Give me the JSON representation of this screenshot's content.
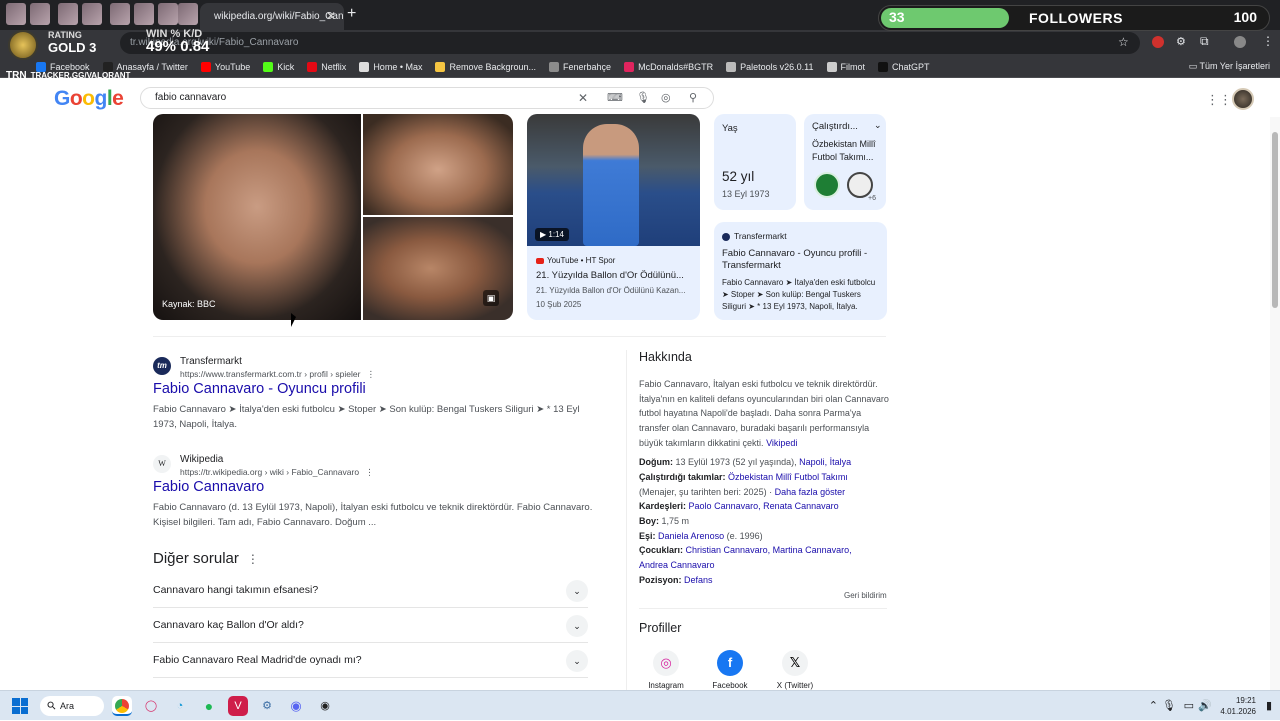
{
  "browser": {
    "active_tab_title": "wikipedia.org/wiki/Fabio_Cann",
    "address_text": "tr.wikipedia.org/wiki/Fabio_Cannavaro",
    "bookmarks": [
      {
        "label": "Facebook",
        "color": "#1877f2",
        "icon": "facebook-icon"
      },
      {
        "label": "Anasayfa / Twitter",
        "color": "#222222",
        "icon": "x-icon"
      },
      {
        "label": "YouTube",
        "color": "#ff0000",
        "icon": "youtube-icon"
      },
      {
        "label": "Kick",
        "color": "#53fc18",
        "icon": "kick-icon"
      },
      {
        "label": "Netflix",
        "color": "#e50914",
        "icon": "netflix-icon"
      },
      {
        "label": "Home • Max",
        "color": "#dddddd",
        "icon": "max-icon"
      },
      {
        "label": "Remove Backgroun...",
        "color": "#f5c542",
        "icon": "removebg-icon"
      },
      {
        "label": "Fenerbahçe",
        "color": "#8c8c8c",
        "icon": "fenerbahce-icon"
      },
      {
        "label": "McDonalds#BGTR",
        "color": "#e0245e",
        "icon": "mcdonalds-icon"
      },
      {
        "label": "Paletools v26.0.11",
        "color": "#bbbbbb",
        "icon": "paletools-icon"
      },
      {
        "label": "Filmot",
        "color": "#cccccc",
        "icon": "filmot-icon"
      },
      {
        "label": "ChatGPT",
        "color": "#111111",
        "icon": "chatgpt-icon"
      }
    ],
    "all_bookmarks_label": "Tüm Yer İşaretleri"
  },
  "overlay": {
    "followers_count": "33",
    "followers_label": "FOLLOWERS",
    "followers_goal": "100",
    "followers_progress": 0.33,
    "rating_label": "RATING",
    "rating_value": "GOLD 3",
    "winrate_label": "WIN %",
    "winrate_value": "49%",
    "kd_label": "K/D",
    "kd_value": "0.84",
    "tracker_brand": "TRN",
    "tracker_url": "TRACKER.GG/VALORANT"
  },
  "google": {
    "logo": "Google",
    "query": "fabio cannavaro",
    "image_source_label": "Kaynak: BBC",
    "video": {
      "duration": "1:14",
      "source": "YouTube • HT Spor",
      "title": "21. Yüzyılda Ballon d'Or Ödülünü...",
      "desc": "21. Yüzyılda Ballon d'Or Ödülünü Kazan...",
      "date": "10 Şub 2025"
    },
    "age_card": {
      "label": "Yaş",
      "value": "52 yıl",
      "date": "13 Eyl 1973"
    },
    "teams_card": {
      "label": "Çalıştırdı...",
      "value": "Özbekistan Millî Futbol Takımı...",
      "more": "+6"
    },
    "transfer_card": {
      "source": "Transfermarkt",
      "title": "Fabio Cannavaro - Oyuncu profili - Transfermarkt",
      "desc": "Fabio Cannavaro ➤ İtalya'den eski futbolcu ➤ Stoper ➤ Son kulüp: Bengal Tuskers Siliguri ➤ * 13 Eyl 1973, Napoli, İtalya."
    },
    "results": [
      {
        "site": "Transfermarkt",
        "url": "https://www.transfermarkt.com.tr › profil › spieler",
        "title": "Fabio Cannavaro - Oyuncu profili",
        "snippet": "Fabio Cannavaro ➤ İtalya'den eski futbolcu ➤ Stoper ➤ Son kulüp: Bengal Tuskers Siliguri ➤ * 13 Eyl 1973, Napoli, İtalya."
      },
      {
        "site": "Wikipedia",
        "url": "https://tr.wikipedia.org › wiki › Fabio_Cannavaro",
        "title": "Fabio Cannavaro",
        "snippet": "Fabio Cannavaro (d. 13 Eylül 1973, Napoli), İtalyan eski futbolcu ve teknik direktördür. Fabio Cannavaro. Kişisel bilgileri. Tam adı, Fabio Cannavaro. Doğum ..."
      }
    ],
    "other_questions_title": "Diğer sorular",
    "faqs": [
      "Cannavaro hangi takımın efsanesi?",
      "Cannavaro kaç Ballon d'Or aldı?",
      "Fabio Cannavaro Real Madrid'de oynadı mı?"
    ],
    "about": {
      "title": "Hakkında",
      "desc": "Fabio Cannavaro, İtalyan eski futbolcu ve teknik direktördür. İtalya'nın en kaliteli defans oyuncularından biri olan Cannavaro futbol hayatına Napoli'de başladı. Daha sonra Parma'ya transfer olan Cannavaro, buradaki başarılı performansıyla büyük takımların dikkatini çekti.",
      "desc_link": "Vikipedi",
      "facts": {
        "birth_label": "Doğum:",
        "birth_value": "13 Eylül 1973 (52 yıl yaşında),",
        "birth_place": "Napoli, İtalya",
        "teams_label": "Çalıştırdığı takımlar:",
        "teams_value": "Özbekistan Millî Futbol Takımı",
        "teams_note": "(Menajer, şu tarihten beri: 2025) ·",
        "teams_more": "Daha fazla göster",
        "siblings_label": "Kardeşleri:",
        "siblings_value": "Paolo Cannavaro, Renata Cannavaro",
        "height_label": "Boy:",
        "height_value": "1,75 m",
        "spouse_label": "Eşi:",
        "spouse_value": "Daniela Arenoso",
        "spouse_note": "(e. 1996)",
        "children_label": "Çocukları:",
        "children_value": "Christian Cannavaro, Martina Cannavaro,",
        "children_value2": "Andrea Cannavaro",
        "position_label": "Pozisyon:",
        "position_value": "Defans"
      },
      "feedback": "Geri bildirim"
    },
    "profiles_title": "Profiller",
    "profiles": [
      "Instagram",
      "Facebook",
      "X (Twitter)"
    ]
  },
  "taskbar": {
    "search_label": "Ara",
    "time": "19:21",
    "date": "4.01.2026"
  }
}
